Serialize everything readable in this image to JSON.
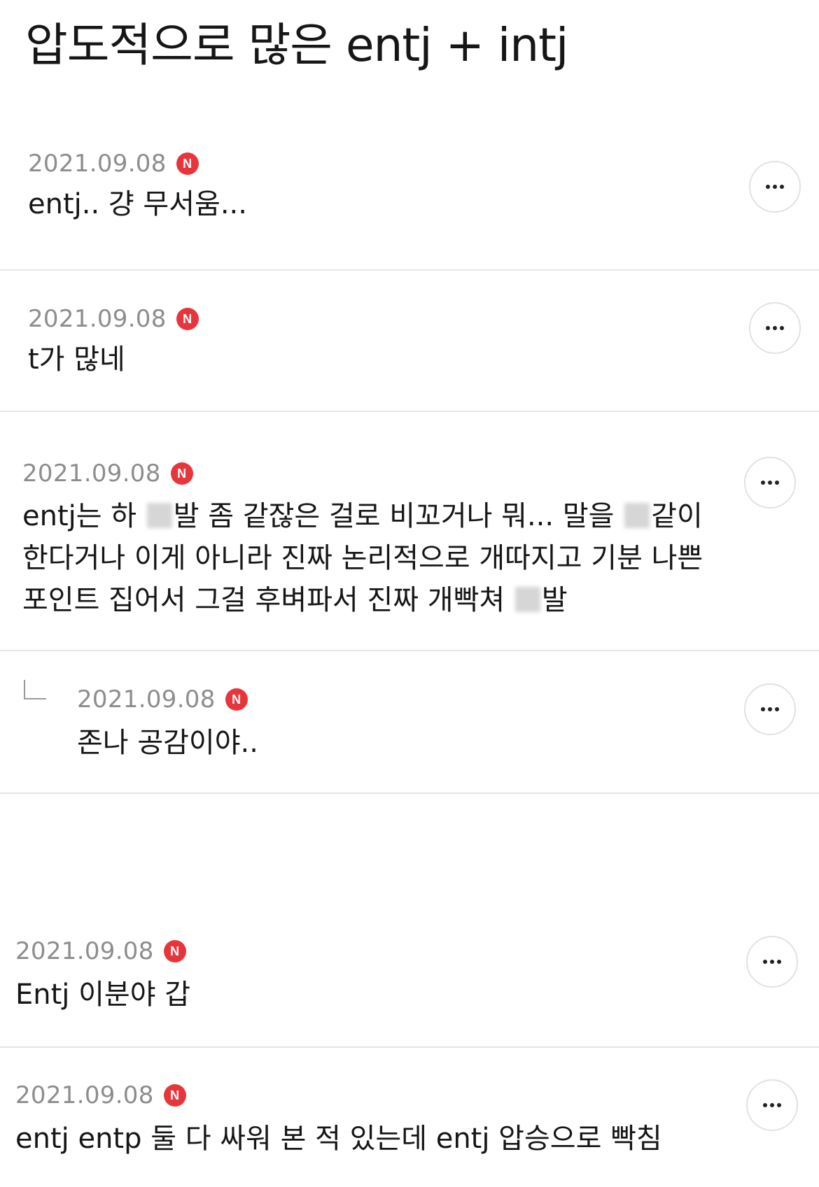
{
  "post": {
    "title": "압도적으로 많은 entj + intj"
  },
  "badge_label": "N",
  "comments": [
    {
      "date": "2021.09.08",
      "lines": [
        "entj.. 걍 무서움..."
      ]
    },
    {
      "date": "2021.09.08",
      "lines": [
        "t가 많네"
      ]
    },
    {
      "date": "2021.09.08",
      "segments": [
        [
          "entj는 하 ",
          "발 좀 같잖은 걸로 비꼬거나 뭐... 말을 ",
          "같이"
        ],
        [
          "한다거나 이게 아니라 진짜 논리적으로 개따지고 기분 나쁜"
        ],
        [
          "포인트 집어서 그걸 후벼파서 진짜 개빡쳐 ",
          "발"
        ]
      ]
    },
    {
      "date": "2021.09.08",
      "lines": [
        "존나 공감이야.."
      ],
      "is_reply": true
    },
    {
      "date": "2021.09.08",
      "lines": [
        "Entj 이분야 갑"
      ]
    },
    {
      "date": "2021.09.08",
      "lines": [
        "entj entp 둘 다 싸워 본 적 있는데 entj 압승으로 빡침"
      ]
    }
  ]
}
